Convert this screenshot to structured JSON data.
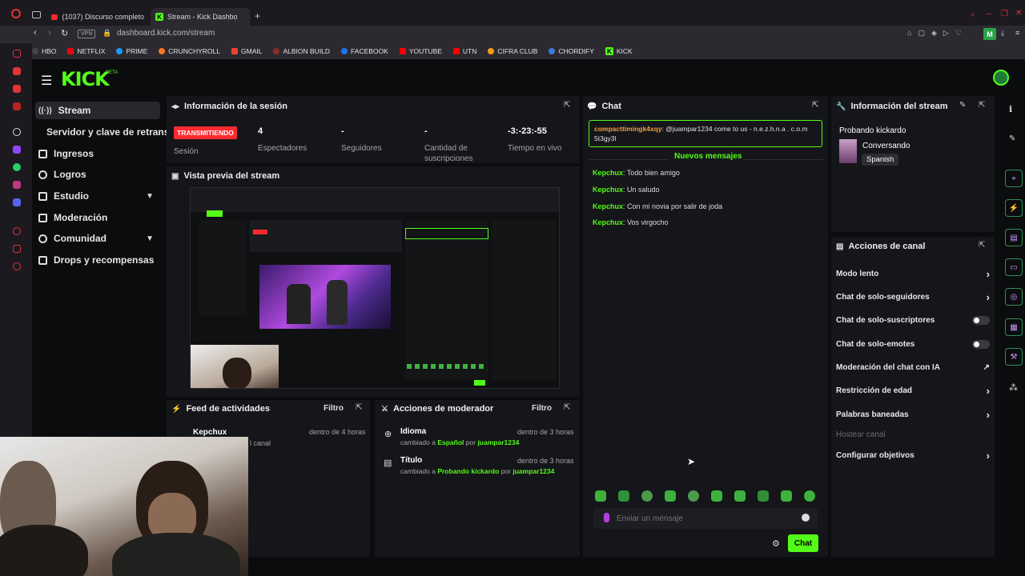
{
  "browser": {
    "tabs": [
      {
        "label": "(1037) Discurso completo",
        "icon": "youtube-icon"
      },
      {
        "label": "Stream - Kick Dashbo",
        "icon": "kick-icon"
      }
    ],
    "vpn_label": "VPN",
    "url": "dashboard.kick.com/stream",
    "bookmarks": [
      "HBO",
      "NETFLIX",
      "PRIME",
      "CRUNCHYROLL",
      "GMAIL",
      "ALBION BUILD",
      "FACEBOOK",
      "YOUTUBE",
      "UTN",
      "CIFRA CLUB",
      "CHORDIFY",
      "KICK"
    ],
    "profile_initial": "M"
  },
  "header": {
    "logo": "KICK",
    "beta": "BETA"
  },
  "sidebar": {
    "items": [
      {
        "label": "Stream",
        "active": true
      },
      {
        "label": "Servidor y clave de retransmi"
      },
      {
        "label": "Ingresos"
      },
      {
        "label": "Logros"
      },
      {
        "label": "Estudio",
        "expandable": true
      },
      {
        "label": "Moderación"
      },
      {
        "label": "Comunidad",
        "expandable": true
      },
      {
        "label": "Drops y recompensas"
      }
    ]
  },
  "session": {
    "title": "Información de la sesión",
    "badge": "TRANSMITIENDO",
    "badge_label": "Sesión",
    "stats": [
      {
        "value": "4",
        "label": "Espectadores"
      },
      {
        "value": "-",
        "label": "Seguidores"
      },
      {
        "value": "-",
        "label": "Cantidad de suscripciones"
      },
      {
        "value": "-3:-23:-55",
        "label": "Tiempo en vivo"
      }
    ]
  },
  "preview": {
    "title": "Vista previa del stream"
  },
  "activity": {
    "title": "Feed de actividades",
    "filter": "Filtro",
    "items": [
      {
        "user": "Kepchux",
        "time": "dentro de 4 horas",
        "text": "l canal"
      }
    ]
  },
  "mod_actions": {
    "title": "Acciones de moderador",
    "filter": "Filtro",
    "items": [
      {
        "title": "Idioma",
        "prefix": "cambiado a",
        "value": "Español",
        "by": "por",
        "user": "juampar1234",
        "time": "dentro de 3 horas"
      },
      {
        "title": "Título",
        "prefix": "cambiado a",
        "value": "Probando kickardo",
        "by": "por",
        "user": "juampar1234",
        "time": "dentro de 3 horas"
      }
    ]
  },
  "chat": {
    "title": "Chat",
    "pinned": {
      "user": "compacttimingk4xqy",
      "text": "@juampar1234 come to us - n.e.z.h.n.a . c.o.m 5t3gy3l"
    },
    "new_messages": "Nuevos mensajes",
    "messages": [
      {
        "user": "Kepchux",
        "text": "Todo bien amigo"
      },
      {
        "user": "Kepchux",
        "text": "Un saludo"
      },
      {
        "user": "Kepchux",
        "text": "Con mi novia por salir de joda"
      },
      {
        "user": "Kepchux",
        "text": "Vos virgocho"
      }
    ],
    "input_placeholder": "Enviar un mensaje",
    "send_label": "Chat"
  },
  "stream_info": {
    "title": "Información del stream",
    "stream_title": "Probando kickardo",
    "category": "Conversando",
    "language": "Spanish"
  },
  "channel_actions": {
    "title": "Acciones de canal",
    "items": [
      {
        "label": "Modo lento",
        "control": "chevron"
      },
      {
        "label": "Chat de solo-seguidores",
        "control": "chevron"
      },
      {
        "label": "Chat de solo-suscriptores",
        "control": "toggle"
      },
      {
        "label": "Chat de solo-emotes",
        "control": "toggle"
      },
      {
        "label": "Moderación del chat con IA",
        "control": "external"
      },
      {
        "label": "Restricción de edad",
        "control": "chevron"
      },
      {
        "label": "Palabras baneadas",
        "control": "chevron"
      },
      {
        "label": "Hostear canal",
        "control": "none",
        "disabled": true
      },
      {
        "label": "Configurar objetivos",
        "control": "chevron"
      }
    ]
  }
}
